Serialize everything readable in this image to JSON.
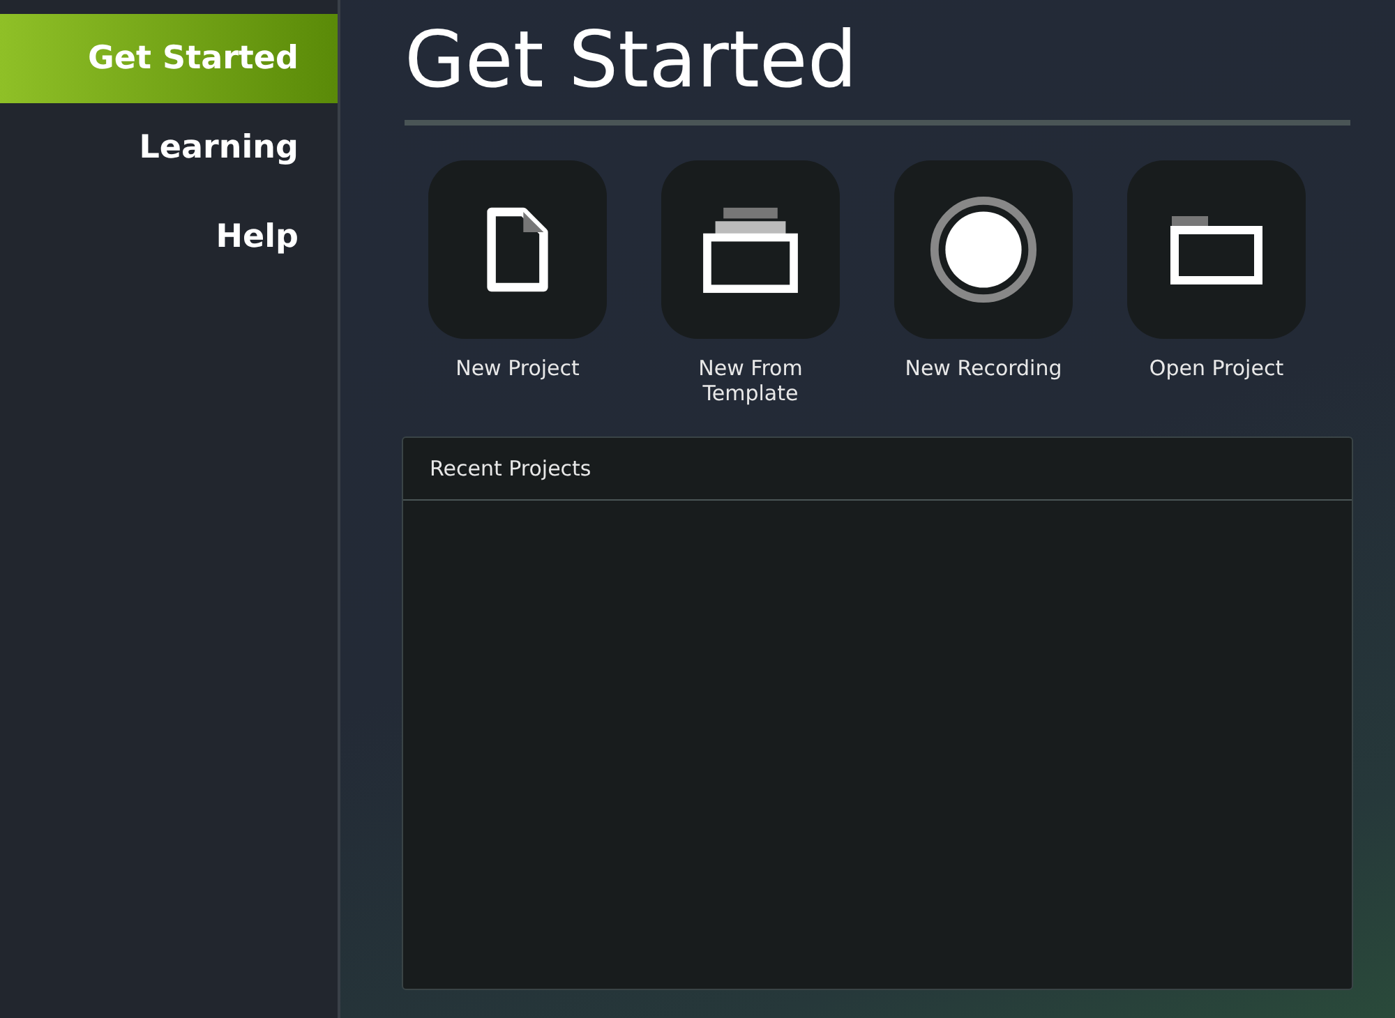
{
  "sidebar": {
    "items": [
      {
        "label": "Get Started",
        "selected": true
      },
      {
        "label": "Learning",
        "selected": false
      },
      {
        "label": "Help",
        "selected": false
      }
    ]
  },
  "title": "Get Started",
  "actions": [
    {
      "label": "New Project",
      "kind": "document"
    },
    {
      "label": "New From Template",
      "kind": "template"
    },
    {
      "label": "New Recording",
      "kind": "record"
    },
    {
      "label": "Open Project",
      "kind": "folder"
    }
  ],
  "recent_projects": {
    "title": "Recent Projects"
  }
}
